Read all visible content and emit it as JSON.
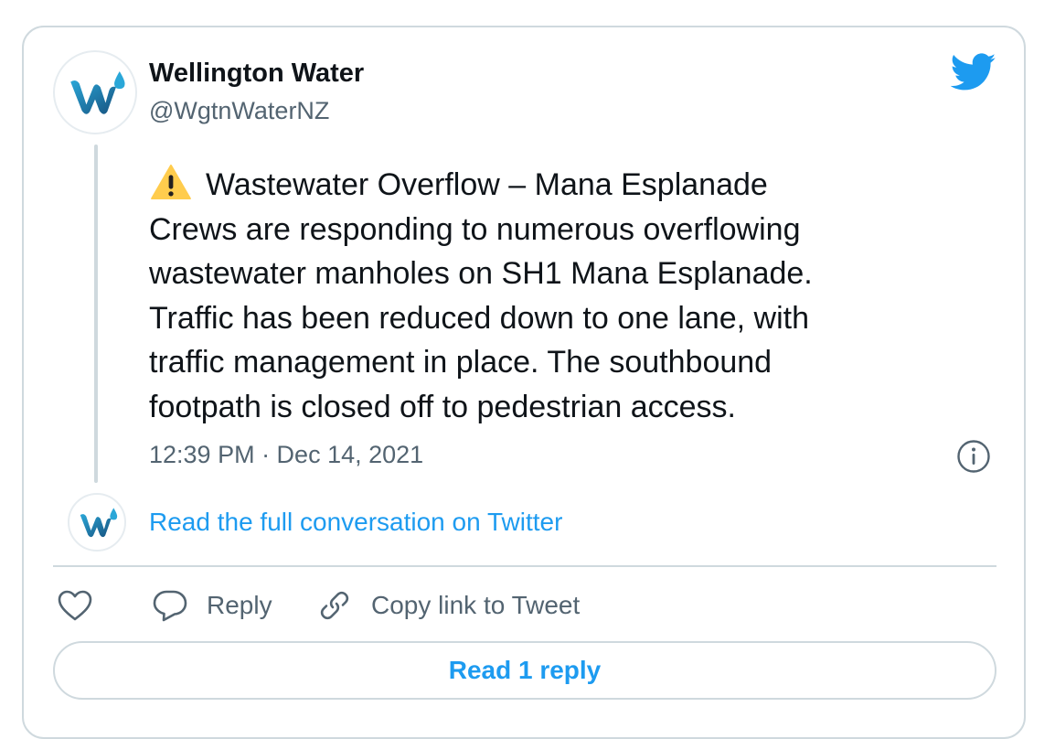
{
  "author": {
    "name": "Wellington Water",
    "handle": "@WgtnWaterNZ"
  },
  "tweet": {
    "lines": [
      "Wastewater Overflow – Mana Esplanade",
      "Crews are responding to numerous overflowing",
      "wastewater manholes on SH1 Mana Esplanade.",
      "Traffic has been reduced down to one lane, with",
      "traffic management in place. The southbound",
      "footpath is closed off to pedestrian access."
    ],
    "timestamp": "12:39 PM · Dec 14, 2021"
  },
  "links": {
    "read_full": "Read the full conversation on Twitter"
  },
  "actions": {
    "reply_label": "Reply",
    "copy_label": "Copy link to Tweet",
    "read_replies_label": "Read 1 reply"
  },
  "icons": {
    "logo": "wellington-water-logo",
    "bird": "twitter-bird-icon",
    "warning": "warning-icon",
    "info": "info-icon",
    "like": "heart-icon",
    "reply": "reply-bubble-icon",
    "copy": "link-icon"
  },
  "colors": {
    "accent": "#1d9bf0",
    "text": "#0f1419",
    "muted": "#536471",
    "border": "#cfd9de",
    "logo_dark": "#1b5e8c",
    "logo_light": "#2aa7d8"
  }
}
